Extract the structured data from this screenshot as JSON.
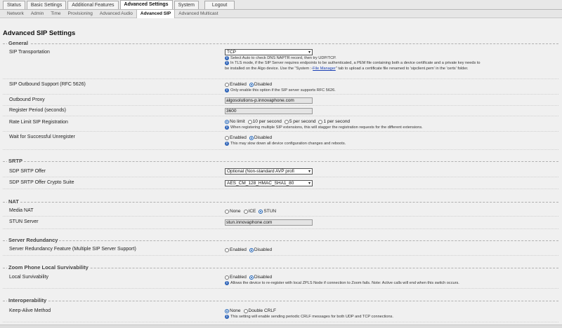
{
  "tabs": {
    "items": [
      {
        "label": "Status"
      },
      {
        "label": "Basic Settings"
      },
      {
        "label": "Additional Features"
      },
      {
        "label": "Advanced Settings",
        "active": true
      },
      {
        "label": "System"
      },
      {
        "label": "Logout"
      }
    ]
  },
  "subtabs": {
    "items": [
      {
        "label": "Network"
      },
      {
        "label": "Admin"
      },
      {
        "label": "Time"
      },
      {
        "label": "Provisioning"
      },
      {
        "label": "Advanced Audio"
      },
      {
        "label": "Advanced SIP",
        "active": true
      },
      {
        "label": "Advanced Multicast"
      }
    ]
  },
  "page": {
    "title": "Advanced SIP Settings"
  },
  "general": {
    "title": "General",
    "sip_transportation": {
      "label": "SIP Transportation",
      "value": "TCP",
      "help1": "Select Auto to check DNS NAPTR record, then try UDP/TCP.",
      "help2a": "In TLS mode, if the SIP Server requires endpoints to be authenticated, a PEM file containing both a device certificate and a private key needs to",
      "help2b_pre": "be installed on the Algo device. Use the \"System :- ",
      "help2b_link": "File Manager",
      "help2b_post": "\" tab to upload a certificate file renamed to 'sipclient.pem' in the 'certs' folder."
    },
    "outbound_support": {
      "label": "SIP Outbound Support (RFC 5626)",
      "opt1": "Enabled",
      "opt2": "Disabled",
      "help": "Only enable this option if the SIP server supports RFC 5626."
    },
    "outbound_proxy": {
      "label": "Outbound Proxy",
      "value": "algosolutions-p.innovaphone.com"
    },
    "register_period": {
      "label": "Register Period (seconds)",
      "value": "3600"
    },
    "rate_limit": {
      "label": "Rate Limit SIP Registration",
      "opt1": "No limit",
      "opt2": "10 per second",
      "opt3": "5 per second",
      "opt4": "1 per second",
      "help": "When registering multiple SIP extensions, this will stagger the registration requests for the different extensions."
    },
    "wait_unregister": {
      "label": "Wait for Successful Unregister",
      "opt1": "Enabled",
      "opt2": "Disabled",
      "help": "This may slow down all device configuration changes and reboots."
    }
  },
  "srtp": {
    "title": "SRTP",
    "sdp_offer": {
      "label": "SDP SRTP Offer",
      "value": "Optional (Non-standard AVP profi"
    },
    "crypto_suite": {
      "label": "SDP SRTP Offer Crypto Suite",
      "value": "AES_CM_128_HMAC_SHA1_80"
    }
  },
  "nat": {
    "title": "NAT",
    "media_nat": {
      "label": "Media NAT",
      "opt1": "None",
      "opt2": "ICE",
      "opt3": "STUN"
    },
    "stun_server": {
      "label": "STUN Server",
      "value": "stun.innovaphone.com"
    }
  },
  "redundancy": {
    "title": "Server Redundancy",
    "feature": {
      "label": "Server Redundancy Feature (Multiple SIP Server Support)",
      "opt1": "Enabled",
      "opt2": "Disabled"
    }
  },
  "zoom": {
    "title": "Zoom Phone Local Survivability",
    "local": {
      "label": "Local Survivability",
      "opt1": "Enabled",
      "opt2": "Disabled",
      "help": "Allows the device to re-register with local ZPLS Node if connection to Zoom fails. Note: Active calls will end when this switch occurs."
    }
  },
  "interop": {
    "title": "Interoperability",
    "keepalive": {
      "label": "Keep-Alive Method",
      "opt1": "None",
      "opt2": "Double CRLF",
      "help": "This setting will enable sending periodic CRLF messages for both UDP and TCP connections."
    }
  },
  "icons": {
    "info": "info-icon",
    "chevron": "chevron-down-icon",
    "radio": "radio-button-icon"
  },
  "colors": {
    "accent": "#2f64b8",
    "link": "#1a3fb4",
    "background": "#f0f0f0"
  }
}
